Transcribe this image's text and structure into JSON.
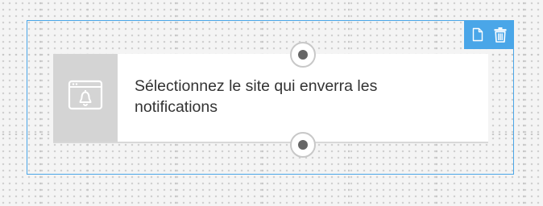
{
  "node": {
    "text": "Sélectionnez le site qui enverra les notifications",
    "icon": "browser-bell-icon"
  },
  "toolbar": {
    "icons": [
      "document-icon",
      "trash-icon"
    ]
  },
  "colors": {
    "accent": "#4aa6e8",
    "icon_box": "#d4d4d4",
    "text": "#333333",
    "connector_dot": "#666666"
  }
}
